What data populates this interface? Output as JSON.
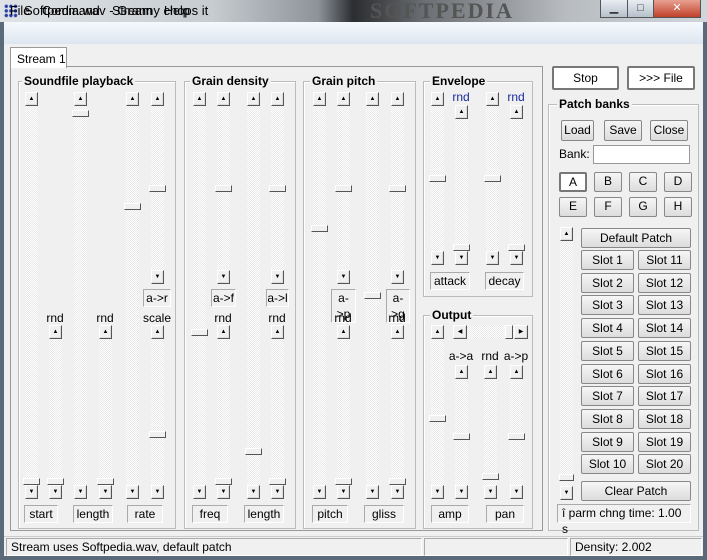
{
  "window": {
    "title": "Softpedia.wav - Granny chops it",
    "watermark": "SOFTPEDIA",
    "minimize": "▁",
    "maximize": "□",
    "close": "✕"
  },
  "menu": [
    "File",
    "Command",
    "Stream",
    "Help"
  ],
  "tab": "Stream 1",
  "groups": {
    "soundfile": {
      "title": "Soundfile playback",
      "labels": [
        "start",
        "length",
        "rate"
      ],
      "rnd": "rnd",
      "scale": "scale",
      "a_r": "a->r"
    },
    "density": {
      "title": "Grain density",
      "labels": [
        "freq",
        "length"
      ],
      "rnd": "rnd",
      "a_f": "a->f",
      "a_l": "a->l"
    },
    "pitch": {
      "title": "Grain pitch",
      "labels": [
        "pitch",
        "gliss"
      ],
      "rnd": "rnd",
      "a_p": "a->p",
      "a_g": "a->g"
    },
    "envelope": {
      "title": "Envelope",
      "labels": [
        "attack",
        "decay"
      ],
      "rnd": "rnd"
    },
    "output": {
      "title": "Output",
      "labels": [
        "amp",
        "pan"
      ],
      "a_a": "a->a",
      "rnd": "rnd",
      "a_p": "a->p",
      "pan_balance": 0.5
    }
  },
  "slider_values": {
    "start": 1.0,
    "start_rnd": 1.0,
    "length": 0.01,
    "length_rnd": 1.0,
    "rate": 0.26,
    "a_r": 0.5,
    "scale": 0.66,
    "freq": 0.6,
    "a_f": 0.5,
    "freq_rnd": 1.0,
    "grain_length": 0.92,
    "a_l": 0.5,
    "length_rnd2": 1.0,
    "pitch": 0.32,
    "a_p": 0.5,
    "pitch_rnd": 1.0,
    "gliss": 0.5,
    "a_g": 0.5,
    "gliss_rnd": 1.0,
    "attack": 0.5,
    "attack_rnd": 1.0,
    "decay": 0.5,
    "decay_rnd": 1.0,
    "amp": 0.55,
    "a_a": 0.55,
    "pan_rnd": 0.95,
    "a_p2": 0.55,
    "patch_scroll": 0.98
  },
  "transport": {
    "stop": "Stop",
    "file": ">>> File"
  },
  "patch_banks": {
    "title": "Patch banks",
    "load": "Load",
    "save": "Save",
    "close": "Close",
    "bank_label": "Bank:",
    "bank_value": "",
    "banks": [
      "A",
      "B",
      "C",
      "D",
      "E",
      "F",
      "G",
      "H"
    ],
    "selected_bank": "A",
    "default_patch": "Default Patch",
    "slots": [
      "Slot 1",
      "Slot 11",
      "Slot 2",
      "Slot 12",
      "Slot 3",
      "Slot 13",
      "Slot 4",
      "Slot 14",
      "Slot 5",
      "Slot 15",
      "Slot 6",
      "Slot 16",
      "Slot 7",
      "Slot 17",
      "Slot 8",
      "Slot 18",
      "Slot 9",
      "Slot 19",
      "Slot 10",
      "Slot 20"
    ],
    "clear_patch": "Clear Patch",
    "parm_time": "î parm chng time: 1.00 s"
  },
  "status": {
    "message": "Stream uses Softpedia.wav, default patch",
    "empty": "",
    "density": "Density: 2.002"
  }
}
